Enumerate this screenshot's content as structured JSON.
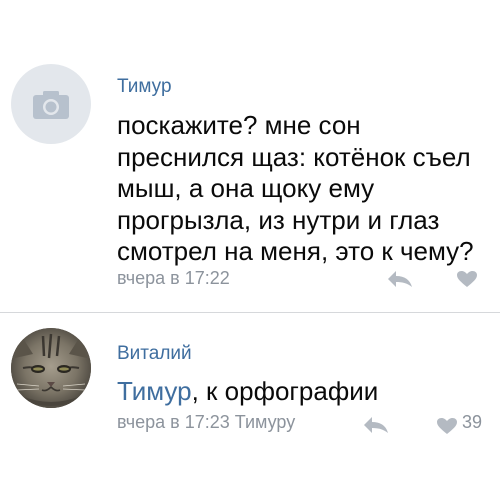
{
  "comments": [
    {
      "author": "Тимур",
      "avatar_icon": "camera-icon",
      "text": "поскажите? мне сон преснился щаз: котёнок съел мыш, а она щоку ему прогрызла, из нутри и глаз смотрел на меня, это к чему?",
      "timestamp": "вчера в 17:22"
    },
    {
      "author": "Виталий",
      "avatar_icon": "cat-photo",
      "reply_to": "Тимур",
      "text_rest": ", к орфографии",
      "timestamp": "вчера в 17:23",
      "reply_target": "Тимуру",
      "likes": "39"
    }
  ],
  "colors": {
    "name": "#3f6e9f",
    "meta": "#8c939c",
    "icon": "#b4bac2",
    "divider": "#d6d8db"
  }
}
